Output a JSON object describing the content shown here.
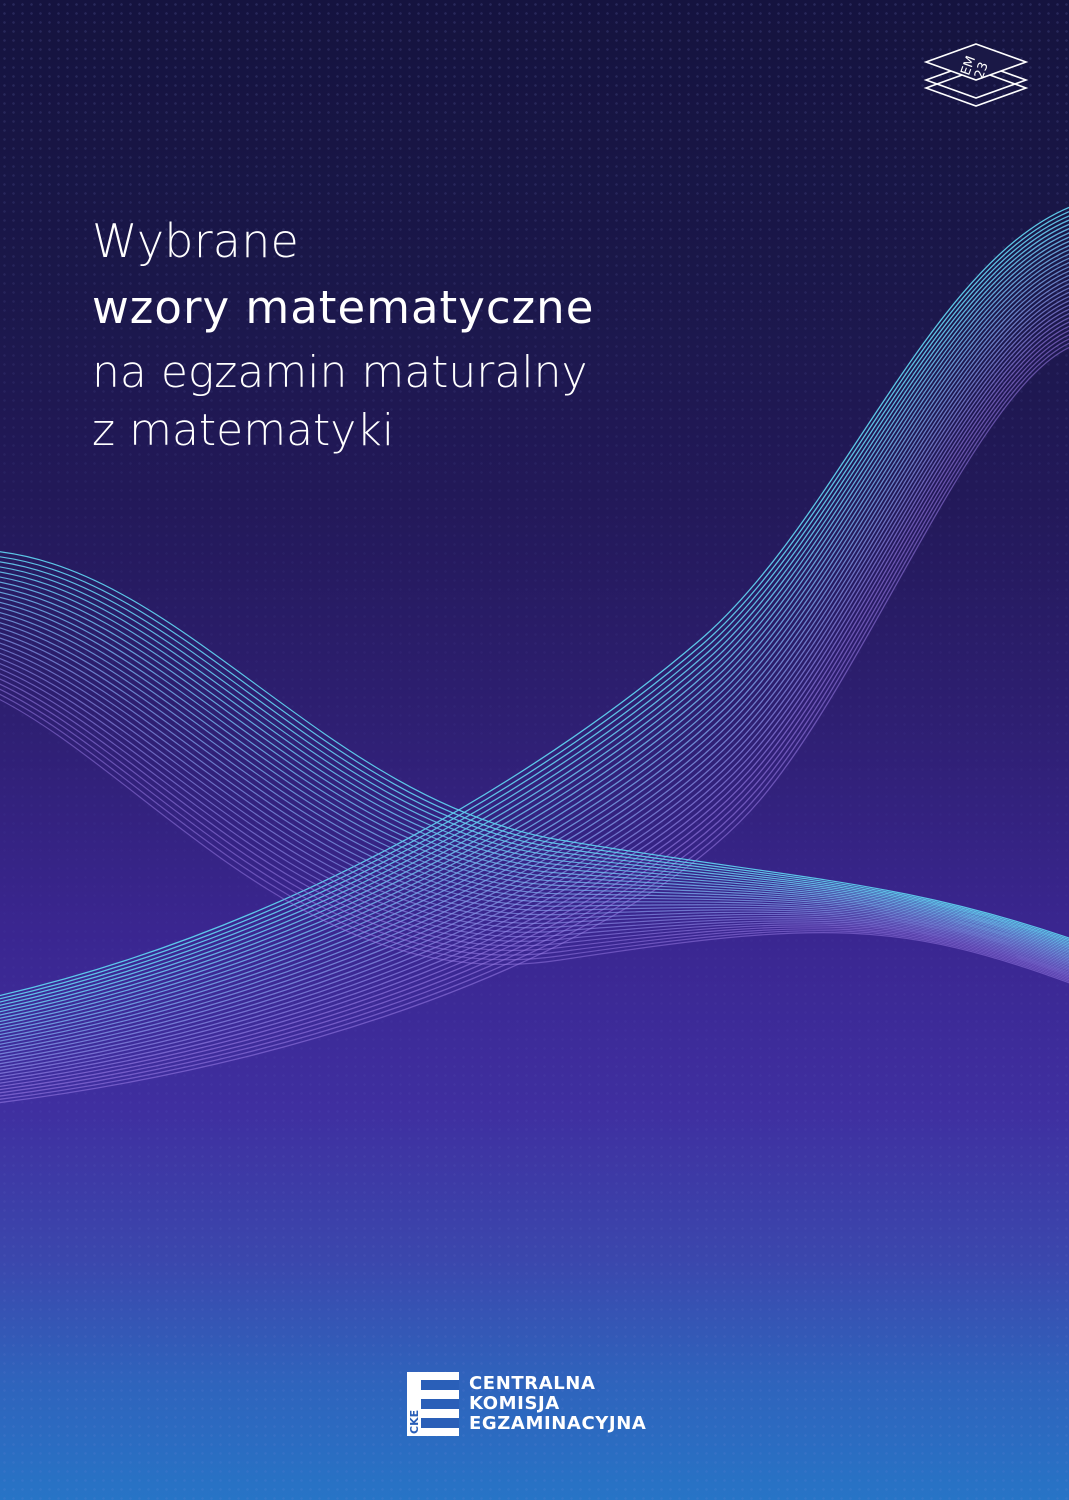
{
  "title": {
    "line1": "Wybrane",
    "line2": "wzory matematyczne",
    "line3": "na egzamin maturalny",
    "line4": "z matematyki"
  },
  "edition_badge": {
    "letters": "EM",
    "year": "23"
  },
  "logo": {
    "mark_letters": "CKE",
    "line1": "CENTRALNA",
    "line2": "KOMISJA",
    "line3": "EGZAMINACYJNA"
  },
  "colors": {
    "wave_cyan": "#5fd0ee",
    "wave_violet": "#9b7ee8",
    "text": "#ffffff"
  }
}
